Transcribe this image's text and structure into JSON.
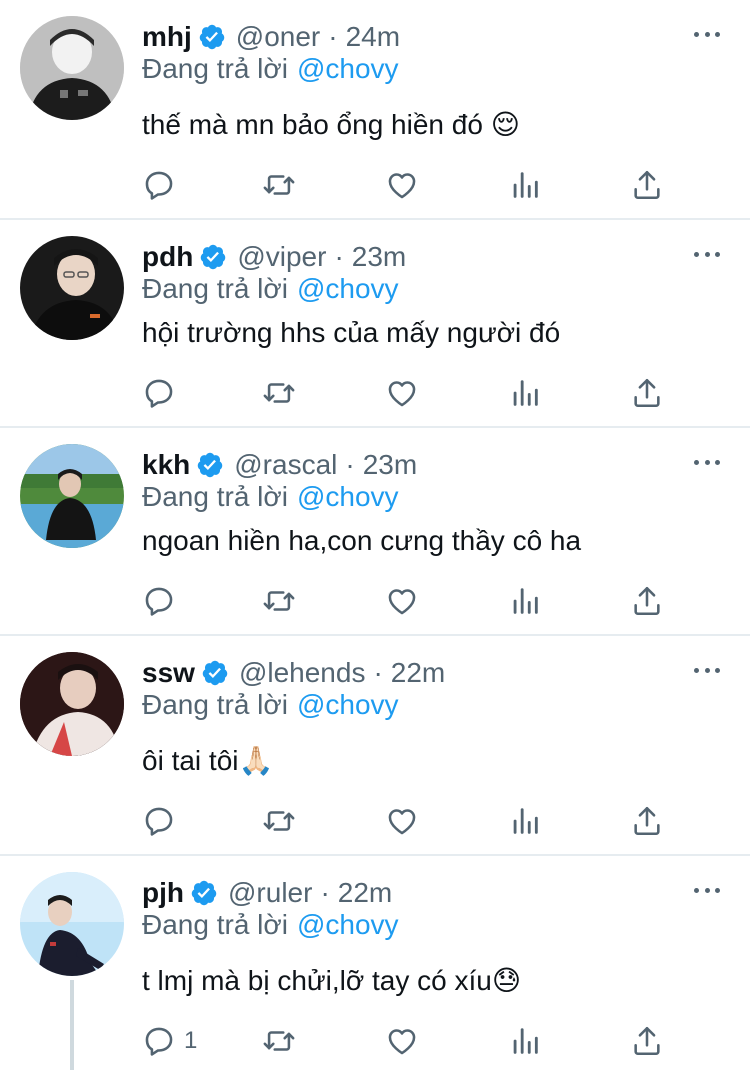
{
  "reply_prefix": "Đang trả lời",
  "colors": {
    "accent": "#1d9bf0",
    "secondary_text": "#536471",
    "divider": "#e6ecf0"
  },
  "icons": [
    "verified-badge-icon",
    "more-icon",
    "reply-icon",
    "retweet-icon",
    "like-icon",
    "views-icon",
    "share-icon"
  ],
  "tweets": [
    {
      "name": "mhj",
      "handle": "@oner",
      "separator": "·",
      "time": "24m",
      "replying_to": "@chovy",
      "text": "thế mà mn bảo ổng hiền đó 😌",
      "reply_count": ""
    },
    {
      "name": "pdh",
      "handle": "@viper",
      "separator": "·",
      "time": "23m",
      "replying_to": "@chovy",
      "text": "hội trường hhs của mấy người đó",
      "reply_count": ""
    },
    {
      "name": "kkh",
      "handle": "@rascal",
      "separator": "·",
      "time": "23m",
      "replying_to": "@chovy",
      "text": "ngoan hiền ha,con cưng thầy cô ha",
      "reply_count": ""
    },
    {
      "name": "ssw",
      "handle": "@lehends",
      "separator": "·",
      "time": "22m",
      "replying_to": "@chovy",
      "text": "ôi tai tôi🙏🏻",
      "reply_count": ""
    },
    {
      "name": "pjh",
      "handle": "@ruler",
      "separator": "·",
      "time": "22m",
      "replying_to": "@chovy",
      "text": "t lmj mà bị chửi,lỡ tay có xíu😓",
      "reply_count": "1"
    }
  ]
}
